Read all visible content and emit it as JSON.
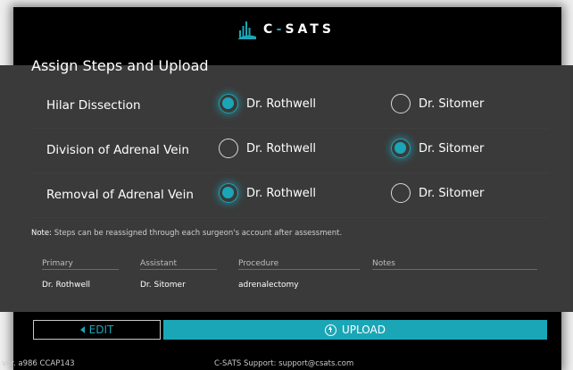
{
  "brand": {
    "logo_prefix": "C",
    "logo_dash": "-",
    "logo_suffix": "SATS",
    "accent": "#1aa6b7"
  },
  "title": "Assign Steps and Upload",
  "steps": [
    {
      "label": "Hilar Dissection",
      "option_a": "Dr. Rothwell",
      "option_b": "Dr. Sitomer",
      "selected": "a"
    },
    {
      "label": "Division of Adrenal Vein",
      "option_a": "Dr. Rothwell",
      "option_b": "Dr. Sitomer",
      "selected": "b"
    },
    {
      "label": "Removal of Adrenal Vein",
      "option_a": "Dr. Rothwell",
      "option_b": "Dr. Sitomer",
      "selected": "a"
    }
  ],
  "note": {
    "key": "Note:",
    "text": "Steps can be reassigned through each surgeon's account after assessment."
  },
  "summary": {
    "headers": [
      "Primary",
      "Assistant",
      "Procedure",
      "Notes"
    ],
    "values": [
      "Dr. Rothwell",
      "Dr. Sitomer",
      "adrenalectomy",
      ""
    ]
  },
  "buttons": {
    "edit_label": "EDIT",
    "upload_label": "UPLOAD"
  },
  "footer": {
    "version": "ver. a986 CCAP143",
    "support": "C-SATS Support: support@csats.com"
  }
}
